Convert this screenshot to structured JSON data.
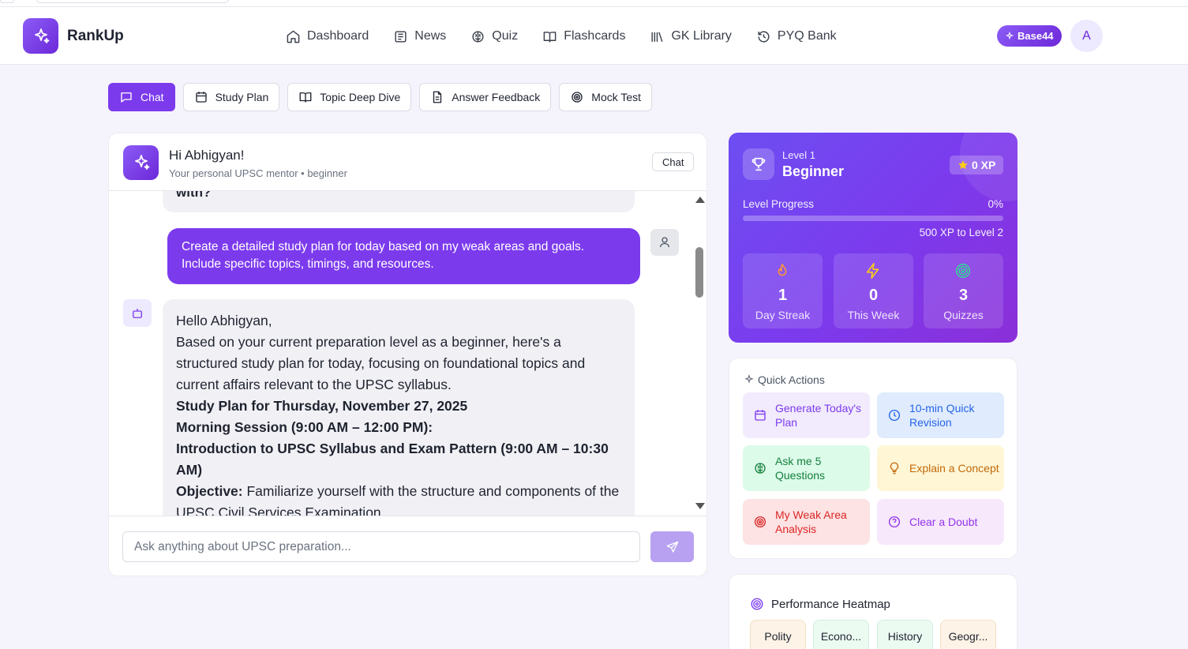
{
  "app": {
    "name": "RankUp"
  },
  "nav": {
    "items": [
      {
        "label": "Dashboard",
        "icon": "home-icon"
      },
      {
        "label": "News",
        "icon": "newspaper-icon"
      },
      {
        "label": "Quiz",
        "icon": "brain-icon"
      },
      {
        "label": "Flashcards",
        "icon": "book-open-icon"
      },
      {
        "label": "GK Library",
        "icon": "library-icon"
      },
      {
        "label": "PYQ Bank",
        "icon": "history-icon"
      }
    ]
  },
  "header": {
    "badge": "Base44",
    "avatar_letter": "A"
  },
  "modes": {
    "tabs": [
      {
        "label": "Chat",
        "active": true
      },
      {
        "label": "Study Plan"
      },
      {
        "label": "Topic Deep Dive"
      },
      {
        "label": "Answer Feedback"
      },
      {
        "label": "Mock Test"
      }
    ]
  },
  "chat": {
    "title": "Hi Abhigyan!",
    "subtitle": "Your personal UPSC mentor • beginner",
    "mode_pill": "Chat",
    "prev_fragment": "with?",
    "user_message": "Create a detailed study plan for today based on my weak areas and goals. Include specific topics, timings, and resources.",
    "bot": {
      "greeting": "Hello Abhigyan,",
      "intro": "Based on your current preparation level as a beginner, here's a structured study plan for today, focusing on foundational topics and current affairs relevant to the UPSC syllabus.",
      "plan_heading": "Study Plan for Thursday, November 27, 2025",
      "session_heading": "Morning Session (9:00 AM – 12:00 PM):",
      "topic_heading": "Introduction to UPSC Syllabus and Exam Pattern (9:00 AM – 10:30 AM)",
      "objective_label": "Objective:",
      "objective_text": " Familiarize yourself with the structure and components of the UPSC Civil Services Examination."
    },
    "input_placeholder": "Ask anything about UPSC preparation..."
  },
  "level_card": {
    "level_label": "Level 1",
    "level_name": "Beginner",
    "xp": "0 XP",
    "progress_label": "Level Progress",
    "progress_text": "0%",
    "progress_value": 0,
    "next_text": "500 XP to Level 2",
    "stats": [
      {
        "value": "1",
        "label": "Day Streak",
        "icon": "flame-icon"
      },
      {
        "value": "0",
        "label": "This Week",
        "icon": "zap-icon"
      },
      {
        "value": "3",
        "label": "Quizzes",
        "icon": "target-icon"
      }
    ]
  },
  "quick_actions": {
    "title": "Quick Actions",
    "items": [
      {
        "label": "Generate Today's Plan",
        "icon": "calendar-icon"
      },
      {
        "label": "10-min Quick Revision",
        "icon": "clock-icon"
      },
      {
        "label": "Ask me 5 Questions",
        "icon": "brain-icon"
      },
      {
        "label": "Explain a Concept",
        "icon": "lightbulb-icon"
      },
      {
        "label": "My Weak Area Analysis",
        "icon": "target-icon"
      },
      {
        "label": "Clear a Doubt",
        "icon": "help-circle-icon"
      }
    ]
  },
  "heatmap": {
    "title": "Performance Heatmap",
    "cells": [
      "Polity",
      "Econo...",
      "History",
      "Geogr..."
    ]
  },
  "colors": {
    "accent": "#7c3aed",
    "accent_light": "#ede9fe"
  }
}
